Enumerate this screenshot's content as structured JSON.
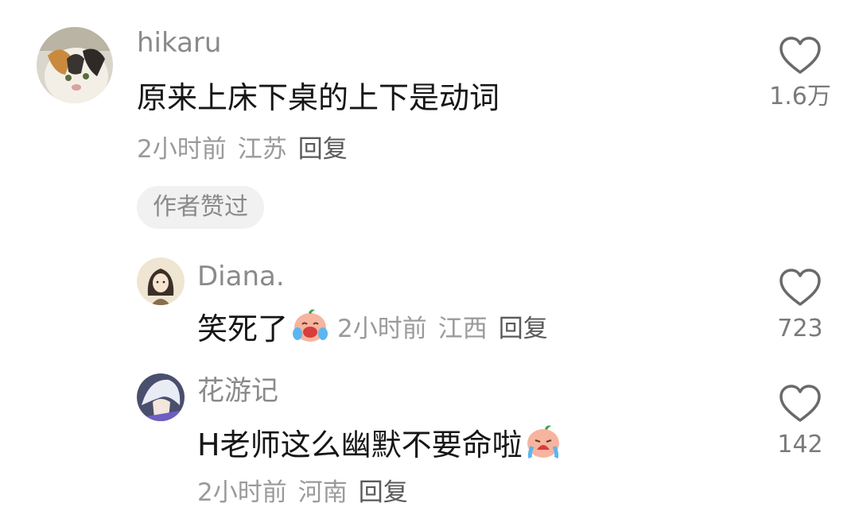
{
  "comments": [
    {
      "user": "hikaru",
      "text": "原来上床下桌的上下是动词",
      "time": "2小时前",
      "location": "江苏",
      "reply_label": "回复",
      "badge": "作者赞过",
      "likes": "1.6万"
    },
    {
      "user": "Diana.",
      "text": "笑死了",
      "emoji": "laughing-crying-face-icon",
      "time": "2小时前",
      "location": "江西",
      "reply_label": "回复",
      "likes": "723"
    },
    {
      "user": "花游记",
      "text": "H老师这么幽默不要命啦",
      "emoji": "crying-face-icon",
      "time": "2小时前",
      "location": "河南",
      "reply_label": "回复",
      "likes": "142"
    }
  ],
  "colors": {
    "name": "#8a8a8a",
    "text": "#161616",
    "meta": "#9a9a9a",
    "reply": "#5a5a5a",
    "badge_bg": "#f1f1f1"
  }
}
